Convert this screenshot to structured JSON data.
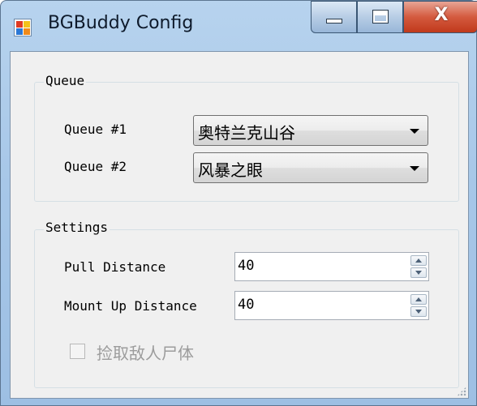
{
  "window": {
    "title": "BGBuddy Config",
    "icon": "app-logo-icon",
    "controls": {
      "minimize": "minimize-icon",
      "maximize": "maximize-icon",
      "close_glyph": "X"
    }
  },
  "queue_group": {
    "legend": "Queue",
    "queue1": {
      "label": "Queue #1",
      "value": "奥特兰克山谷"
    },
    "queue2": {
      "label": "Queue #2",
      "value": "风暴之眼"
    }
  },
  "settings_group": {
    "legend": "Settings",
    "pull_distance": {
      "label": "Pull Distance",
      "value": "40"
    },
    "mount_up_distance": {
      "label": "Mount Up Distance",
      "value": "40"
    },
    "loot_corpses": {
      "label": "捡取敌人尸体",
      "checked": false,
      "enabled": false
    }
  }
}
